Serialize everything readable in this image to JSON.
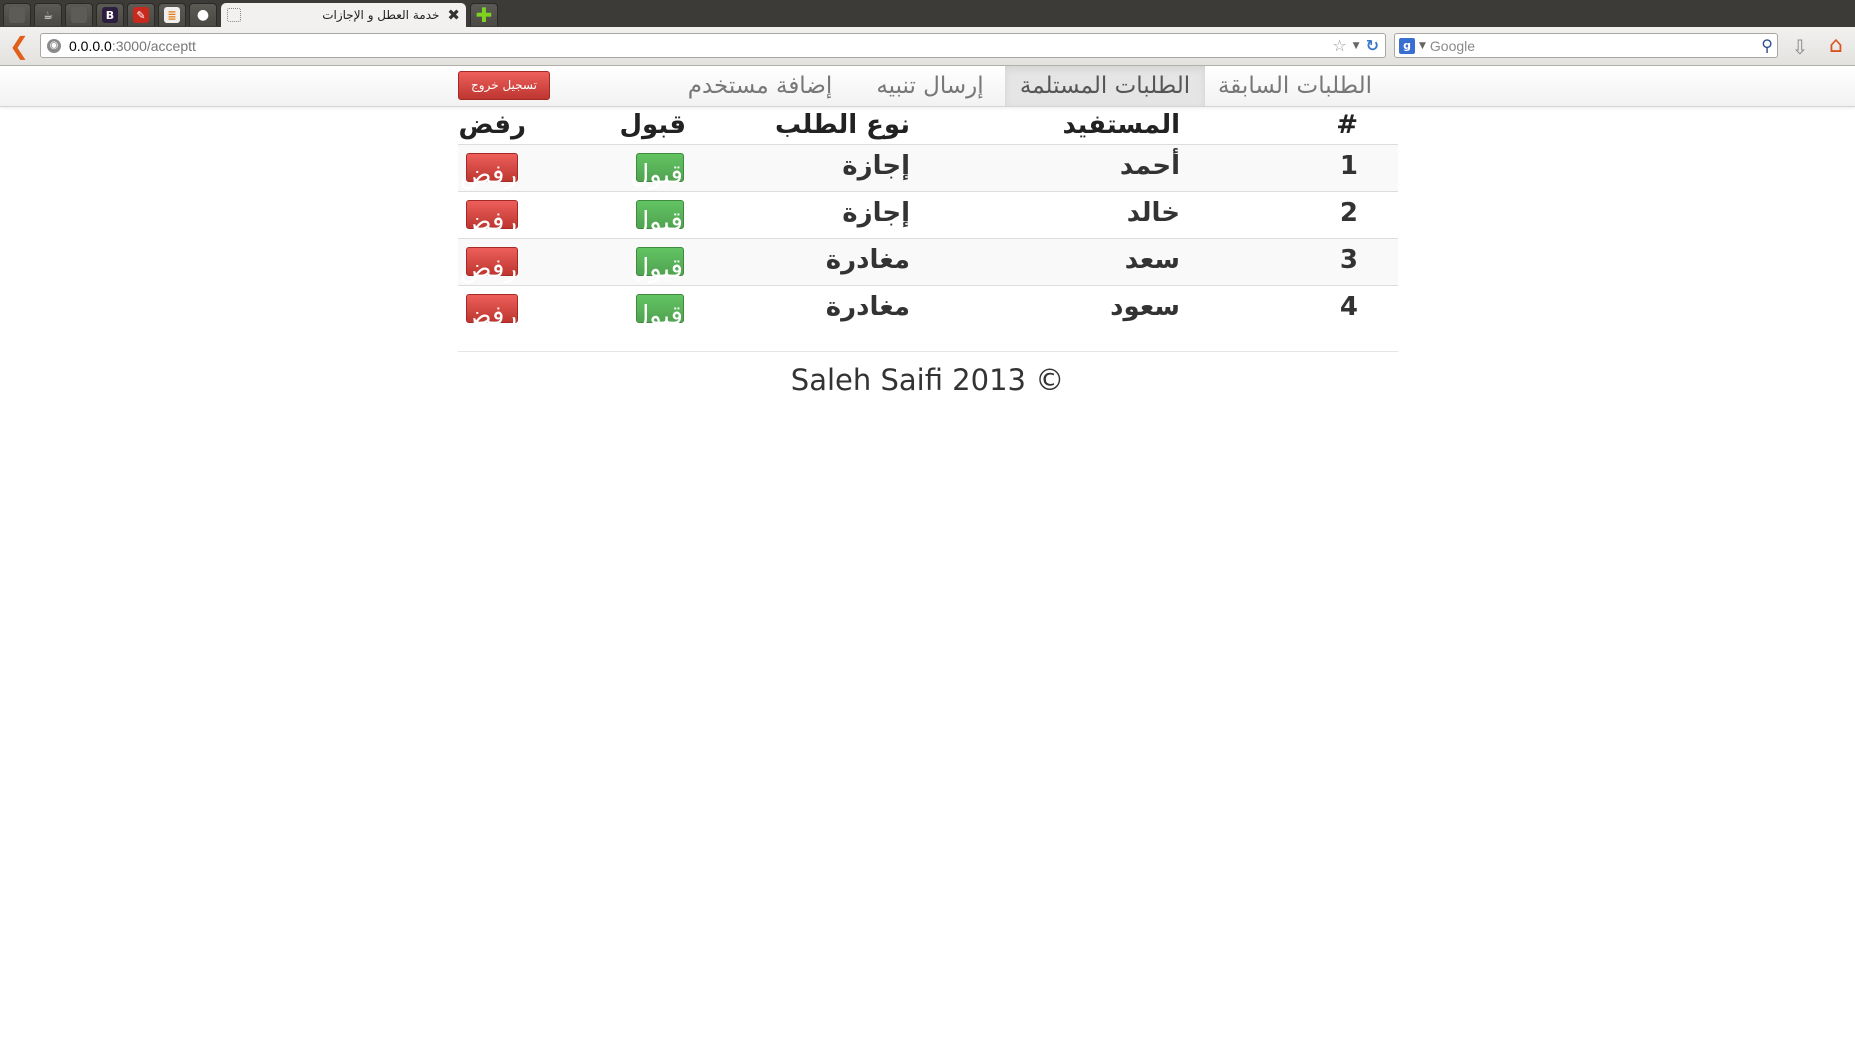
{
  "browser": {
    "tab_title": "خدمة العطل و الإجازات",
    "url_host": "0.0.0.0",
    "url_path": ":3000/acceptt",
    "search_placeholder": "Google",
    "pinned_tabs": [
      {
        "icon": "blank-tab-icon",
        "glyph": ""
      },
      {
        "icon": "coffee-icon",
        "glyph": "☕"
      },
      {
        "icon": "blank-tab-icon",
        "glyph": ""
      },
      {
        "icon": "bootstrap-icon",
        "glyph": "B"
      },
      {
        "icon": "rails-icon",
        "glyph": "✎"
      },
      {
        "icon": "stack-icon",
        "glyph": "≣"
      },
      {
        "icon": "github-icon",
        "glyph": "●"
      }
    ]
  },
  "nav": {
    "items": [
      {
        "label": "الطلبات السابقة",
        "active": false
      },
      {
        "label": "الطلبات المستلمة",
        "active": true
      },
      {
        "label": "إرسال تنبيه",
        "active": false
      },
      {
        "label": "إضافة مستخدم",
        "active": false
      }
    ],
    "logout_label": "تسجيل خروج"
  },
  "table": {
    "headers": {
      "num": "#",
      "beneficiary": "المستفيد",
      "type": "نوع الطلب",
      "accept": "قبول",
      "reject": "رفض"
    },
    "rows": [
      {
        "num": "1",
        "beneficiary": "أحمد",
        "type": "إجازة",
        "accept": "قبول",
        "reject": "رفض"
      },
      {
        "num": "2",
        "beneficiary": "خالد",
        "type": "إجازة",
        "accept": "قبول",
        "reject": "رفض"
      },
      {
        "num": "3",
        "beneficiary": "سعد",
        "type": "مغادرة",
        "accept": "قبول",
        "reject": "رفض"
      },
      {
        "num": "4",
        "beneficiary": "سعود",
        "type": "مغادرة",
        "accept": "قبول",
        "reject": "رفض"
      }
    ]
  },
  "footer": {
    "text": "Saleh Saifi 2013 ©"
  },
  "colors": {
    "success": "#5bb75b",
    "danger": "#da4f49",
    "nav_active_bg": "#e5e5e5"
  }
}
